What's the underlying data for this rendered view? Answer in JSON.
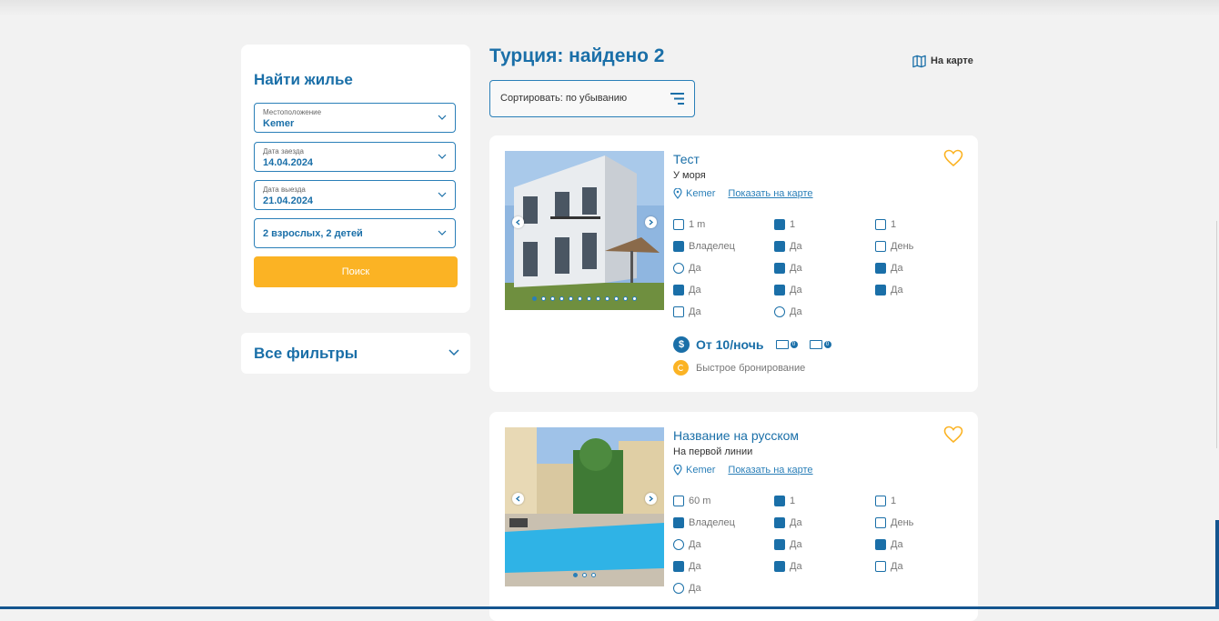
{
  "sidebar": {
    "title": "Найти жилье",
    "location": {
      "label": "Местоположение",
      "value": "Kemer"
    },
    "checkin": {
      "label": "Дата заезда",
      "value": "14.04.2024"
    },
    "checkout": {
      "label": "Дата выезда",
      "value": "21.04.2024"
    },
    "guests": {
      "value": "2 взрослых, 2 детей"
    },
    "search_button": "Поиск",
    "filters_title": "Все фильтры"
  },
  "results": {
    "title": "Турция: найдено 2",
    "map_link": "На карте",
    "sort_label": "Сортировать: по убыванию"
  },
  "listings": [
    {
      "name": "Тест",
      "subtitle": "У моря",
      "location": "Kemer",
      "map_link": "Показать на карте",
      "photo_dots": 12,
      "features": [
        {
          "icon": "area-icon",
          "text": "1 m"
        },
        {
          "icon": "guests-icon",
          "text": "1"
        },
        {
          "icon": "bedrooms-icon",
          "text": "1"
        },
        {
          "icon": "owner-icon",
          "text": "Владелец"
        },
        {
          "icon": "shower-icon",
          "text": "Да"
        },
        {
          "icon": "calendar-icon",
          "text": "День"
        },
        {
          "icon": "sea-icon",
          "text": "Да"
        },
        {
          "icon": "pets-icon",
          "text": "Да"
        },
        {
          "icon": "pool-icon",
          "text": "Да"
        },
        {
          "icon": "wifi-icon",
          "text": "Да"
        },
        {
          "icon": "building-icon",
          "text": "Да"
        },
        {
          "icon": "gift-icon",
          "text": "Да"
        },
        {
          "icon": "washer-icon",
          "text": "Да"
        },
        {
          "icon": "kids-icon",
          "text": "Да"
        }
      ],
      "price": "От 10/ночь",
      "price_badge_1": "0",
      "price_badge_2": "0",
      "quick_booking": "Быстрое бронирование"
    },
    {
      "name": "Название на русском",
      "subtitle": "На первой линии",
      "location": "Kemer",
      "map_link": "Показать на карте",
      "photo_dots": 3,
      "features": [
        {
          "icon": "area-icon",
          "text": "60 m"
        },
        {
          "icon": "guests-icon",
          "text": "1"
        },
        {
          "icon": "bedrooms-icon",
          "text": "1"
        },
        {
          "icon": "owner-icon",
          "text": "Владелец"
        },
        {
          "icon": "shower-icon",
          "text": "Да"
        },
        {
          "icon": "calendar-icon",
          "text": "День"
        },
        {
          "icon": "sea-icon",
          "text": "Да"
        },
        {
          "icon": "pool-icon",
          "text": "Да"
        },
        {
          "icon": "wifi-icon",
          "text": "Да"
        },
        {
          "icon": "building-icon",
          "text": "Да"
        },
        {
          "icon": "gift-icon",
          "text": "Да"
        },
        {
          "icon": "washer-icon",
          "text": "Да"
        },
        {
          "icon": "kids-icon",
          "text": "Да"
        }
      ]
    }
  ],
  "colors": {
    "primary": "#1a6fa8",
    "accent": "#fbb324",
    "background": "#f2f2f2"
  }
}
